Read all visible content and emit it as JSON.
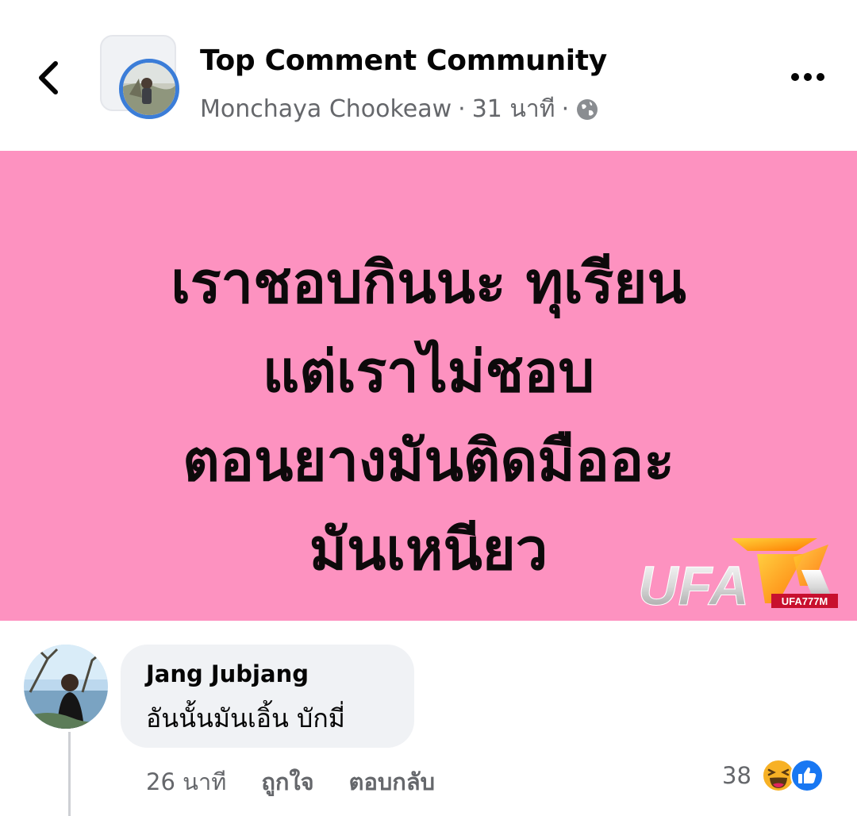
{
  "header": {
    "group_name": "Top Comment Community",
    "author": "Monchaya Chookeaw",
    "separator": "·",
    "time": "31 นาที",
    "icons": {
      "back": "chevron-left-icon",
      "privacy": "globe-icon",
      "more": "more-dots-icon"
    }
  },
  "post": {
    "background_color": "#fd92c0",
    "lines": [
      "เราชอบกินนะ ทุเรียน",
      "แต่เราไม่ชอบ",
      "ตอนยางมันติดมืออะ",
      "มันเหนียว"
    ],
    "watermark": {
      "main": "UFA",
      "tag": "UFA777M"
    }
  },
  "comment": {
    "author": "Jang Jubjang",
    "text": "อันนั้นมันเอิ้น บักมี่",
    "time": "26 นาที",
    "like_label": "ถูกใจ",
    "reply_label": "ตอบกลับ",
    "reaction_count": "38",
    "reaction_icons": [
      "haha-icon",
      "like-icon"
    ]
  },
  "colors": {
    "accent": "#1877f2",
    "secondary_text": "#65676b",
    "bubble": "#f0f2f5"
  }
}
